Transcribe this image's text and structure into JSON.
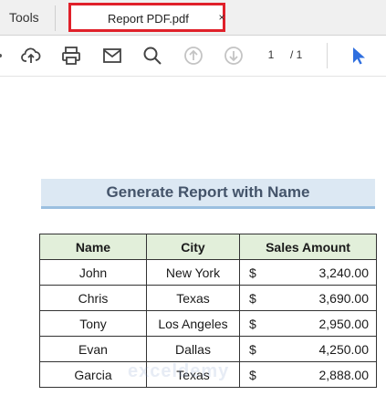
{
  "tabs": {
    "tools_label": "Tools",
    "active_tab_title": "Report PDF.pdf",
    "close_glyph": "×"
  },
  "toolbar": {
    "icons": [
      "upload-cloud-icon",
      "print-icon",
      "mail-icon",
      "zoom-icon",
      "page-up-icon",
      "page-down-icon",
      "select-cursor-icon"
    ],
    "page_current": "1",
    "page_total": "/ 1"
  },
  "report": {
    "title": "Generate Report with Name",
    "headers": {
      "name": "Name",
      "city": "City",
      "sales": "Sales Amount"
    },
    "rows": [
      {
        "name": "John",
        "city": "New York",
        "currency": "$",
        "amount": "3,240.00"
      },
      {
        "name": "Chris",
        "city": "Texas",
        "currency": "$",
        "amount": "3,690.00"
      },
      {
        "name": "Tony",
        "city": "Los Angeles",
        "currency": "$",
        "amount": "2,950.00"
      },
      {
        "name": "Evan",
        "city": "Dallas",
        "currency": "$",
        "amount": "4,250.00"
      },
      {
        "name": "Garcia",
        "city": "Texas",
        "currency": "$",
        "amount": "2,888.00"
      }
    ],
    "watermark": "exceldemy"
  },
  "colors": {
    "tab_highlight": "#e0202a",
    "title_band": "#dce8f3",
    "header_fill": "#e2efda",
    "accent_blue": "#2f6fdf"
  }
}
